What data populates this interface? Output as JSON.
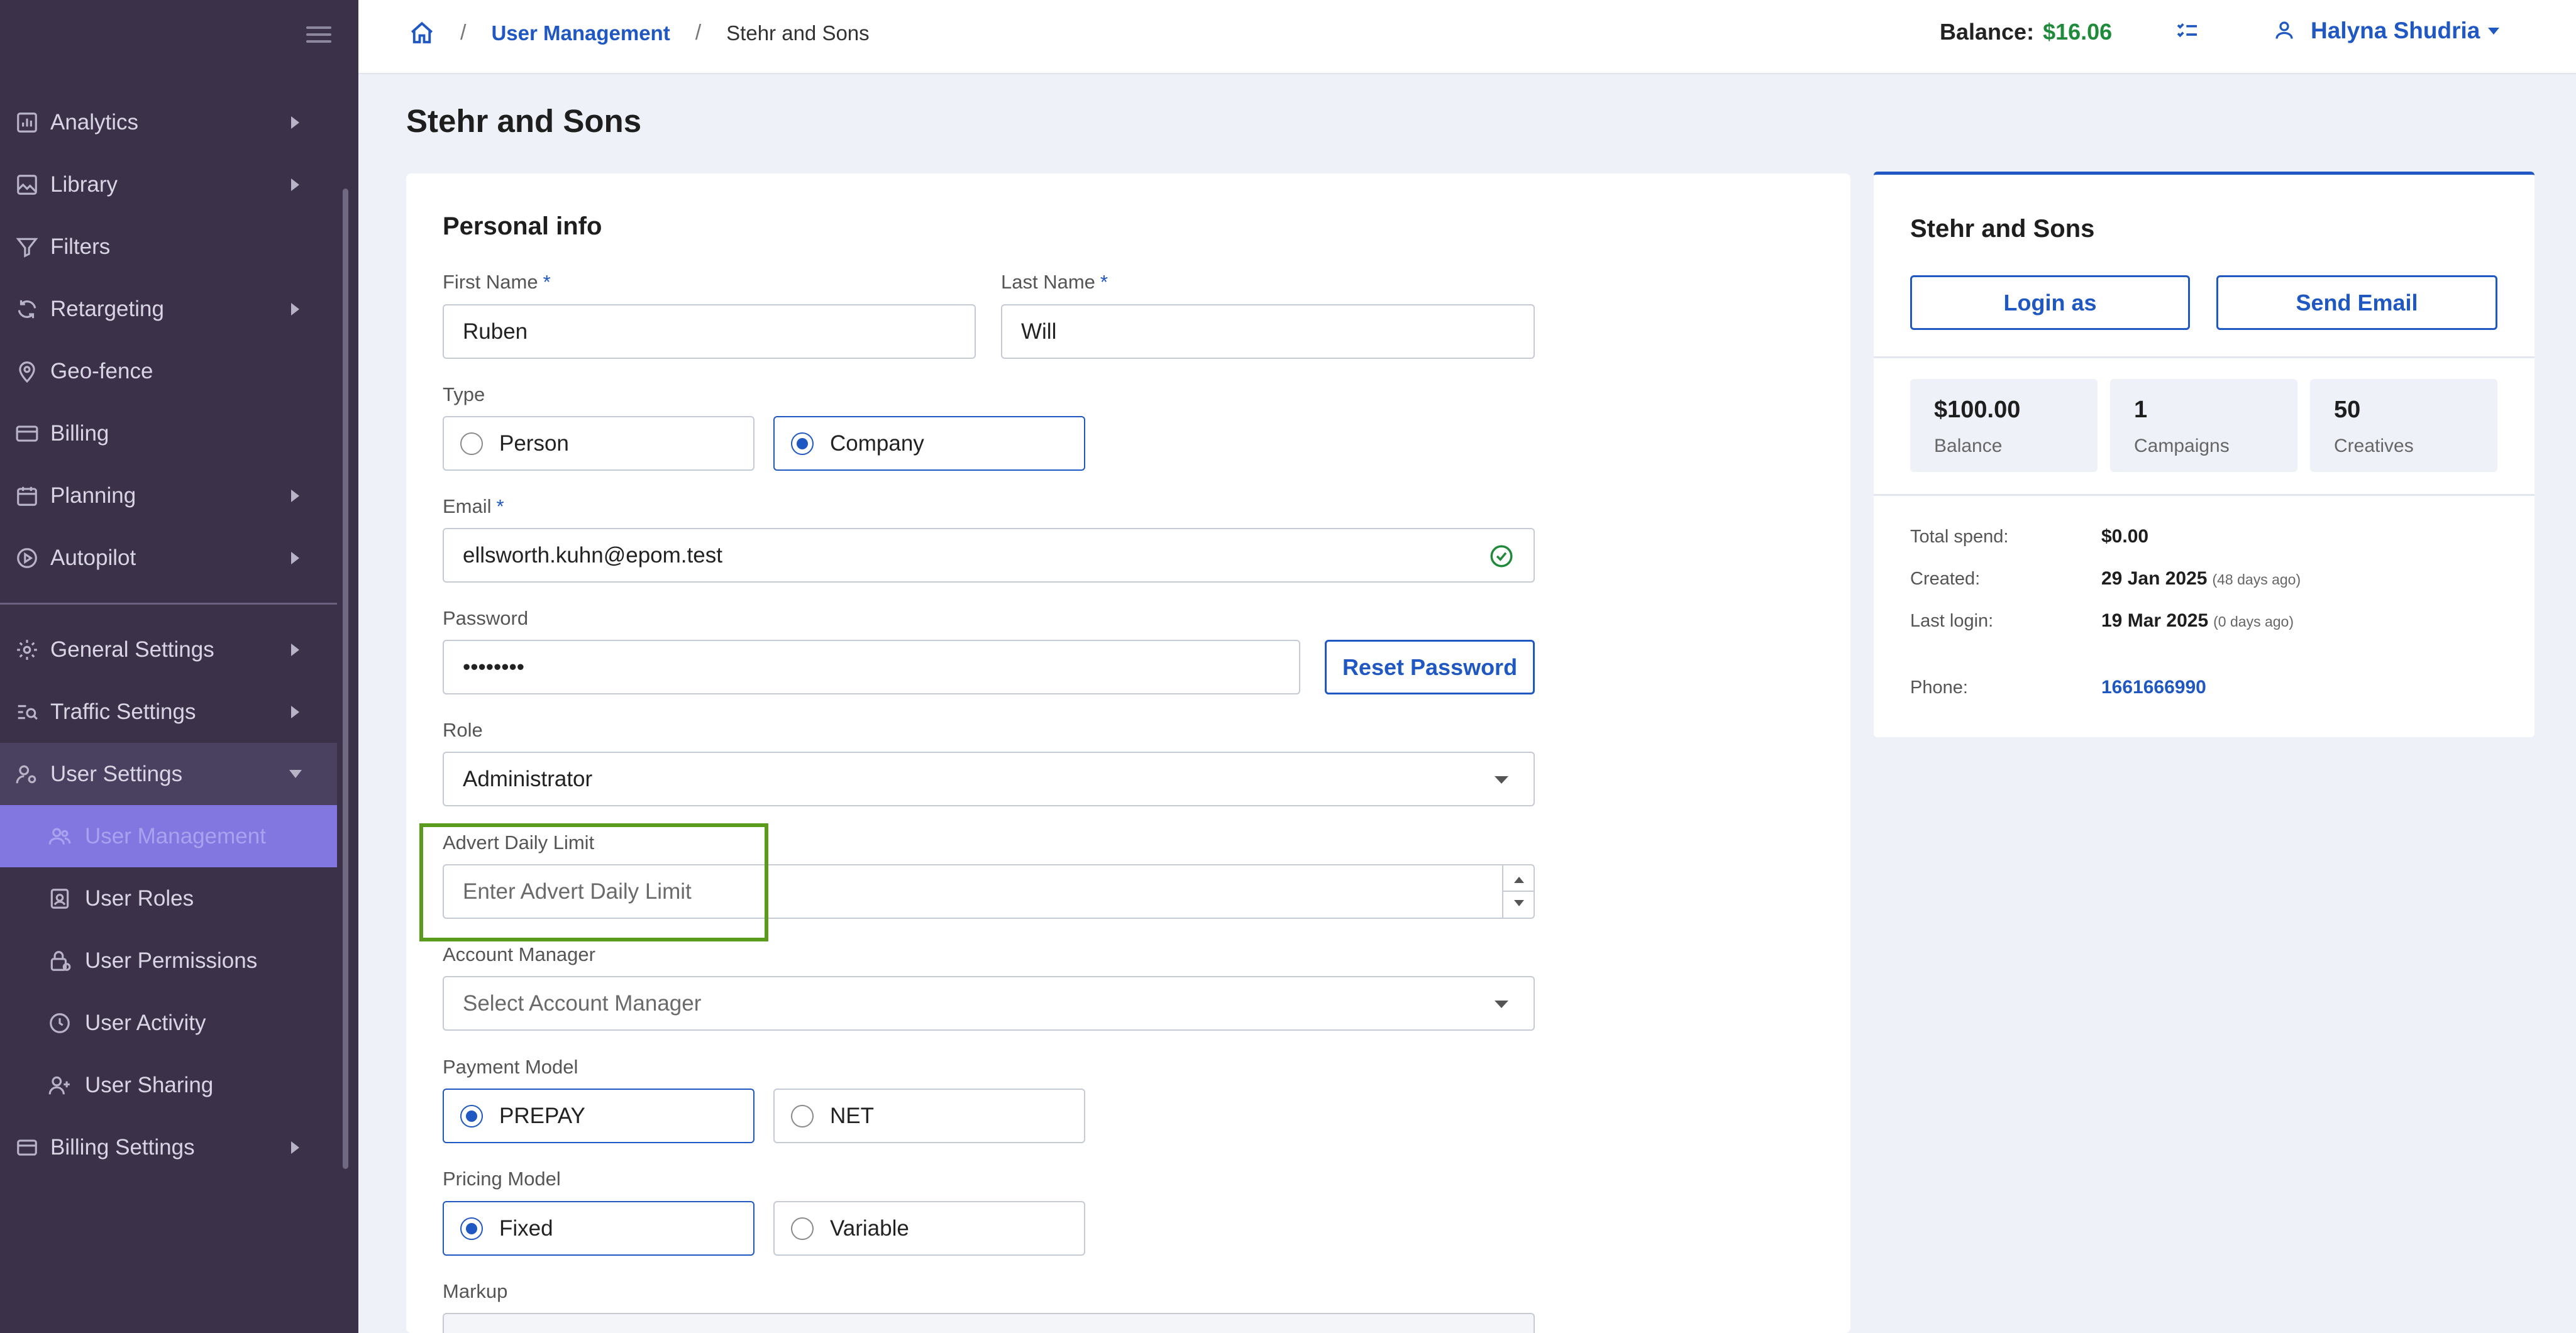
{
  "sidebar": {
    "items": [
      {
        "label": "Analytics",
        "icon": "bar-chart-icon",
        "has_arrow": true
      },
      {
        "label": "Library",
        "icon": "image-icon",
        "has_arrow": true
      },
      {
        "label": "Filters",
        "icon": "filter-icon",
        "has_arrow": false
      },
      {
        "label": "Retargeting",
        "icon": "refresh-icon",
        "has_arrow": true
      },
      {
        "label": "Geo-fence",
        "icon": "map-pin-icon",
        "has_arrow": false
      },
      {
        "label": "Billing",
        "icon": "credit-card-icon",
        "has_arrow": false
      },
      {
        "label": "Planning",
        "icon": "calendar-icon",
        "has_arrow": true
      },
      {
        "label": "Autopilot",
        "icon": "play-circle-icon",
        "has_arrow": true
      }
    ],
    "settings": [
      {
        "label": "General Settings",
        "icon": "gear-icon"
      },
      {
        "label": "Traffic Settings",
        "icon": "traffic-search-icon"
      },
      {
        "label": "User Settings",
        "icon": "user-gear-icon"
      }
    ],
    "user_sub": [
      {
        "label": "User Management",
        "icon": "users-icon",
        "active": true
      },
      {
        "label": "User Roles",
        "icon": "id-badge-icon",
        "active": false
      },
      {
        "label": "User Permissions",
        "icon": "lock-icon",
        "active": false
      },
      {
        "label": "User Activity",
        "icon": "clock-icon",
        "active": false
      },
      {
        "label": "User Sharing",
        "icon": "user-plus-icon",
        "active": false
      }
    ],
    "billing_settings": "Billing Settings"
  },
  "header": {
    "breadcrumb": {
      "link": "User Management",
      "current": "Stehr and Sons"
    },
    "balance_label": "Balance:",
    "balance_value": "$16.06",
    "user_name": "Halyna Shudria"
  },
  "page": {
    "title": "Stehr and Sons"
  },
  "form": {
    "section_title": "Personal info",
    "first_name": {
      "label": "First Name",
      "value": "Ruben"
    },
    "last_name": {
      "label": "Last Name",
      "value": "Will"
    },
    "type": {
      "label": "Type",
      "options": [
        "Person",
        "Company"
      ],
      "selected": "Company"
    },
    "email": {
      "label": "Email",
      "value": "ellsworth.kuhn@epom.test"
    },
    "password": {
      "label": "Password",
      "value": "••••••••",
      "reset_label": "Reset Password"
    },
    "role": {
      "label": "Role",
      "value": "Administrator"
    },
    "advert_daily_limit": {
      "label": "Advert Daily Limit",
      "placeholder": "Enter Advert Daily Limit"
    },
    "account_manager": {
      "label": "Account Manager",
      "placeholder": "Select Account Manager"
    },
    "payment_model": {
      "label": "Payment Model",
      "options": [
        "PREPAY",
        "NET"
      ],
      "selected": "PREPAY"
    },
    "pricing_model": {
      "label": "Pricing Model",
      "options": [
        "Fixed",
        "Variable"
      ],
      "selected": "Fixed"
    },
    "markup": {
      "label": "Markup"
    }
  },
  "summary": {
    "title": "Stehr and Sons",
    "login_as": "Login as",
    "send_email": "Send Email",
    "stats": [
      {
        "value": "$100.00",
        "label": "Balance"
      },
      {
        "value": "1",
        "label": "Campaigns"
      },
      {
        "value": "50",
        "label": "Creatives"
      }
    ],
    "total_spend": {
      "label": "Total spend:",
      "value": "$0.00"
    },
    "created": {
      "label": "Created:",
      "value": "29 Jan 2025",
      "note": "(48 days ago)"
    },
    "last_login": {
      "label": "Last login:",
      "value": "19 Mar 2025",
      "note": "(0 days ago)"
    },
    "phone": {
      "label": "Phone:",
      "value": "1661666990"
    }
  },
  "colors": {
    "sidebar_bg": "#3b3249",
    "accent": "#1f57c3",
    "active_item": "#8277e0",
    "highlight": "#5a9a1c",
    "balance": "#1e8a3a"
  }
}
